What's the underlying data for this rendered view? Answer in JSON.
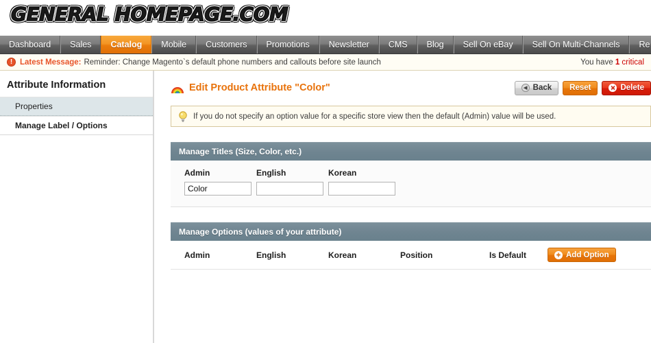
{
  "logo": {
    "text": "General Homepage.com"
  },
  "topnav": {
    "items": [
      {
        "label": "Dashboard",
        "active": false
      },
      {
        "label": "Sales",
        "active": false
      },
      {
        "label": "Catalog",
        "active": true
      },
      {
        "label": "Mobile",
        "active": false
      },
      {
        "label": "Customers",
        "active": false
      },
      {
        "label": "Promotions",
        "active": false
      },
      {
        "label": "Newsletter",
        "active": false
      },
      {
        "label": "CMS",
        "active": false
      },
      {
        "label": "Blog",
        "active": false
      },
      {
        "label": "Sell On eBay",
        "active": false
      },
      {
        "label": "Sell On Multi-Channels",
        "active": false
      },
      {
        "label": "Re",
        "active": false
      }
    ]
  },
  "message_bar": {
    "icon": "alert-circle-icon",
    "label": "Latest Message:",
    "text": "Reminder: Change Magento`s default phone numbers and callouts before site launch",
    "right_prefix": "You have ",
    "right_count": "1",
    "right_suffix": " critical",
    "label_color": "#e8542a",
    "critical_color": "#cc0000"
  },
  "sidebar": {
    "title": "Attribute Information",
    "items": [
      {
        "label": "Properties",
        "current": false
      },
      {
        "label": "Manage Label / Options",
        "current": true
      }
    ]
  },
  "content": {
    "title": "Edit Product Attribute \"Color\"",
    "title_icon": "rainbow-icon",
    "title_color": "#e8720b",
    "buttons": [
      {
        "label": "Back",
        "style": "gray",
        "icon": "back-arrow-circle-icon"
      },
      {
        "label": "Reset",
        "style": "orange",
        "icon": ""
      },
      {
        "label": "Delete",
        "style": "red",
        "icon": "close-circle-icon"
      }
    ],
    "notice": {
      "icon": "lightbulb-icon",
      "text": "If you do not specify an option value for a specific store view then the default (Admin) value will be used."
    },
    "manage_titles": {
      "heading": "Manage Titles (Size, Color, etc.)",
      "columns": [
        {
          "label": "Admin",
          "value": "Color"
        },
        {
          "label": "English",
          "value": ""
        },
        {
          "label": "Korean",
          "value": ""
        }
      ]
    },
    "manage_options": {
      "heading": "Manage Options (values of your attribute)",
      "columns": [
        "Admin",
        "English",
        "Korean",
        "Position",
        "Is Default"
      ],
      "add_button": {
        "label": "Add Option",
        "icon": "plus-circle-icon"
      },
      "rows": []
    }
  }
}
